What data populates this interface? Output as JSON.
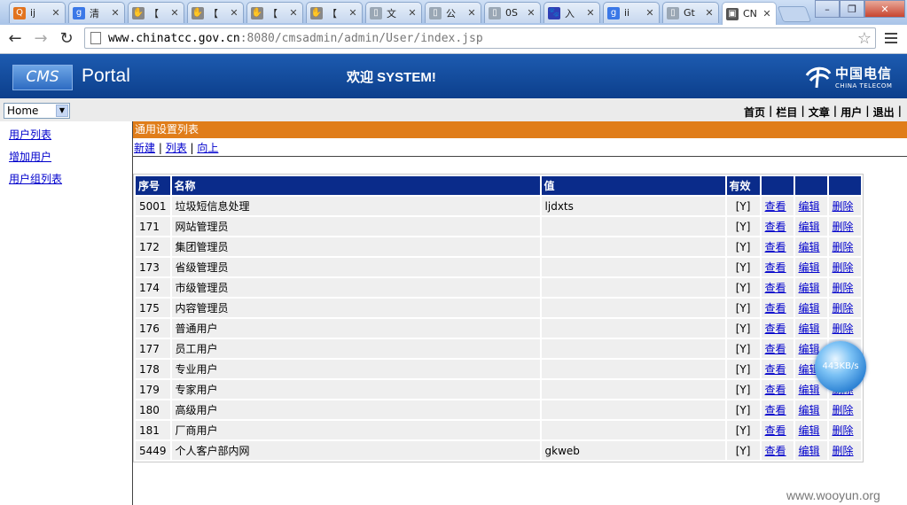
{
  "browser": {
    "tabs": [
      {
        "title": "ij",
        "favicon": "qq-icon",
        "color": "#e2731e",
        "glyph": "Q"
      },
      {
        "title": "清",
        "favicon": "google-icon",
        "color": "#3b78e7",
        "glyph": "g"
      },
      {
        "title": "【",
        "favicon": "hand-icon",
        "color": "#888888",
        "glyph": "✋"
      },
      {
        "title": "【",
        "favicon": "hand-icon",
        "color": "#888888",
        "glyph": "✋"
      },
      {
        "title": "【",
        "favicon": "hand-icon",
        "color": "#888888",
        "glyph": "✋"
      },
      {
        "title": "【",
        "favicon": "hand-icon",
        "color": "#888888",
        "glyph": "✋"
      },
      {
        "title": "文",
        "favicon": "page-icon",
        "color": "#9aa7b5",
        "glyph": "▯"
      },
      {
        "title": "公",
        "favicon": "page-icon",
        "color": "#9aa7b5",
        "glyph": "▯"
      },
      {
        "title": "0S",
        "favicon": "page-icon",
        "color": "#9aa7b5",
        "glyph": "▯"
      },
      {
        "title": "入",
        "favicon": "baidu-paw-icon",
        "color": "#2f3fb5",
        "glyph": "🐾"
      },
      {
        "title": "ii",
        "favicon": "google-icon",
        "color": "#3b78e7",
        "glyph": "g"
      },
      {
        "title": "Gt",
        "favicon": "page-icon",
        "color": "#9aa7b5",
        "glyph": "▯"
      },
      {
        "title": "CN",
        "favicon": "cms-icon",
        "color": "#555555",
        "glyph": "▣"
      }
    ],
    "url_host": "www.chinatcc.gov.cn",
    "url_rest": ":8080/cmsadmin/admin/User/index.jsp"
  },
  "header": {
    "logo": "CMS",
    "portal": "Portal",
    "welcome": "欢迎 SYSTEM!",
    "brand_cn": "中国电信",
    "brand_en": "CHINA TELECOM"
  },
  "nav": {
    "select_value": "Home",
    "top_links": [
      "首页",
      "栏目",
      "文章",
      "用户",
      "退出"
    ]
  },
  "sidebar": {
    "items": [
      "用户列表",
      "增加用户",
      "用户组列表"
    ]
  },
  "content": {
    "section_title": "通用设置列表",
    "actions": [
      "新建",
      "列表",
      "向上"
    ],
    "columns": [
      "序号",
      "名称",
      "值",
      "有效",
      "",
      "",
      ""
    ],
    "rows": [
      {
        "id": "5001",
        "name": "垃圾短信息处理",
        "value": "ljdxts",
        "valid": "[Y]"
      },
      {
        "id": "171",
        "name": "网站管理员",
        "value": "",
        "valid": "[Y]"
      },
      {
        "id": "172",
        "name": "集团管理员",
        "value": "",
        "valid": "[Y]"
      },
      {
        "id": "173",
        "name": "省级管理员",
        "value": "",
        "valid": "[Y]"
      },
      {
        "id": "174",
        "name": "市级管理员",
        "value": "",
        "valid": "[Y]"
      },
      {
        "id": "175",
        "name": "内容管理员",
        "value": "",
        "valid": "[Y]"
      },
      {
        "id": "176",
        "name": "普通用户",
        "value": "",
        "valid": "[Y]"
      },
      {
        "id": "177",
        "name": "员工用户",
        "value": "",
        "valid": "[Y]"
      },
      {
        "id": "178",
        "name": "专业用户",
        "value": "",
        "valid": "[Y]"
      },
      {
        "id": "179",
        "name": "专家用户",
        "value": "",
        "valid": "[Y]"
      },
      {
        "id": "180",
        "name": "高级用户",
        "value": "",
        "valid": "[Y]"
      },
      {
        "id": "181",
        "name": "厂商用户",
        "value": "",
        "valid": "[Y]"
      },
      {
        "id": "5449",
        "name": "个人客户部内网",
        "value": "gkweb",
        "valid": "[Y]"
      }
    ],
    "row_actions": [
      "查看",
      "编辑",
      "删除"
    ]
  },
  "overlay": {
    "speed": "443KB/s"
  },
  "watermark": "www.wooyun.org",
  "colors": {
    "header_blue": "#0c3f8c",
    "section_orange": "#e07d1a",
    "table_head": "#0a2b8a",
    "link": "#0000cc"
  }
}
